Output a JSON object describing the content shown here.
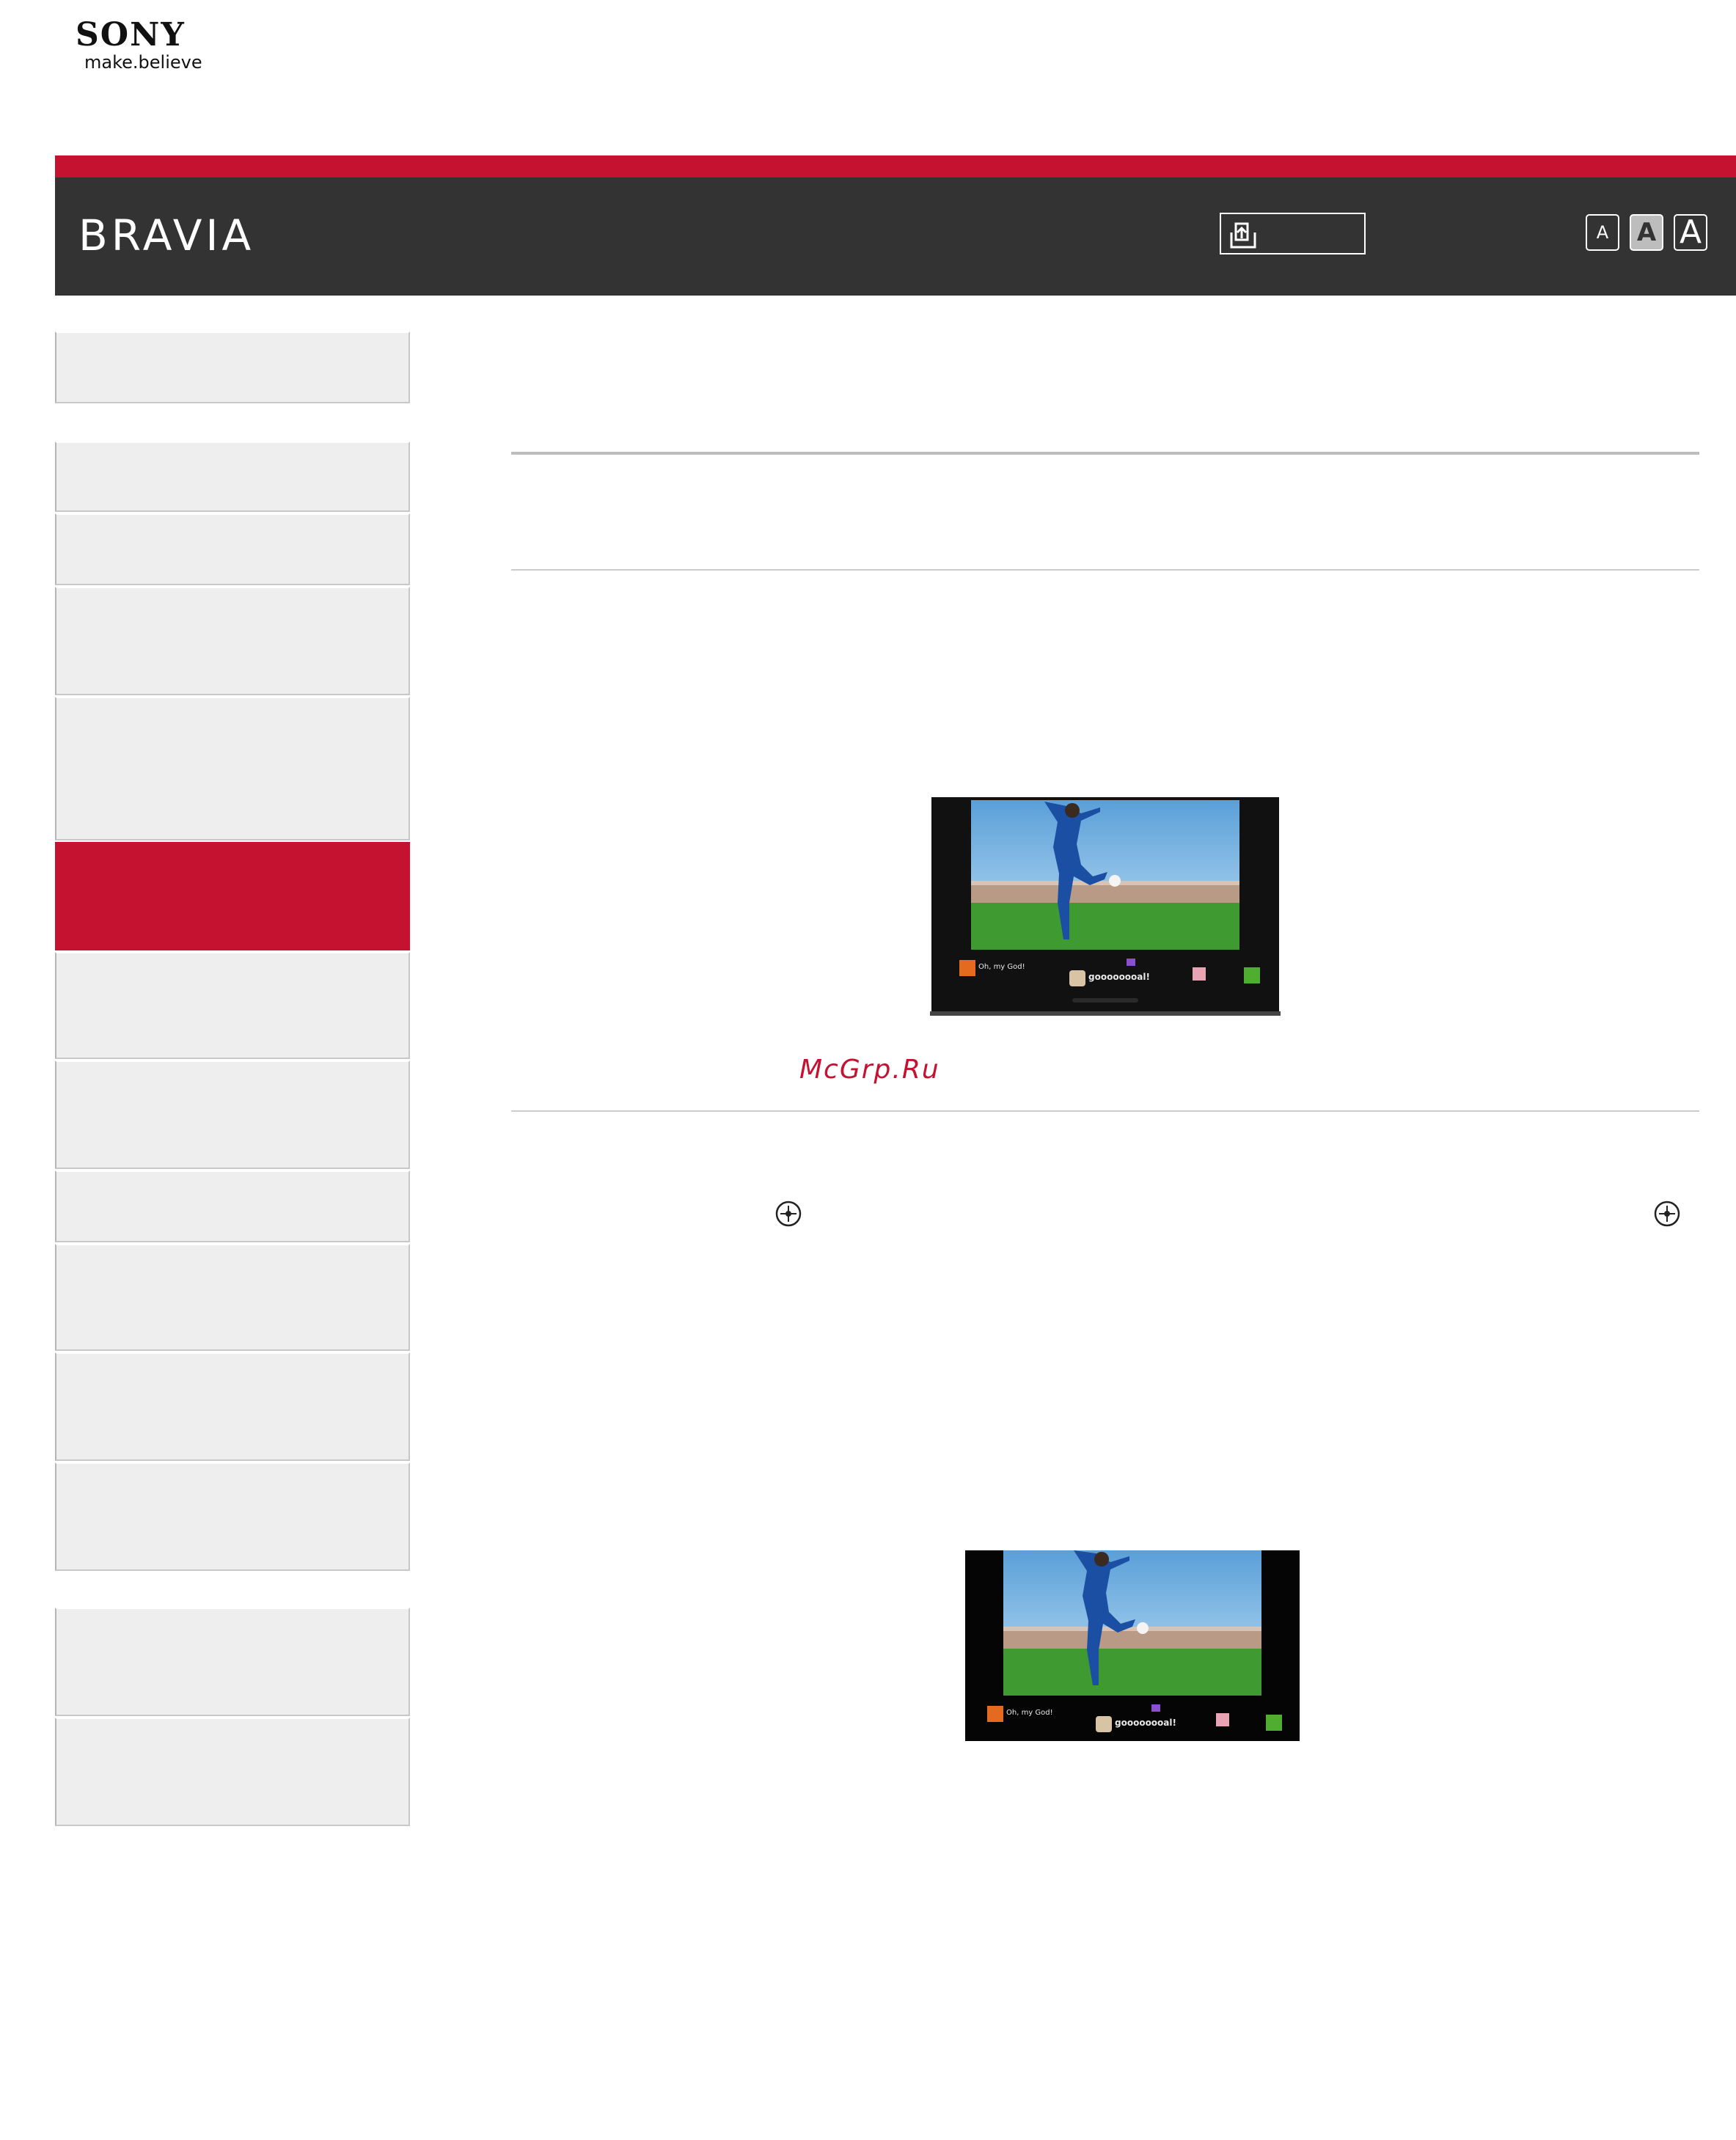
{
  "brand": {
    "name": "SONY",
    "tagline": "make.believe"
  },
  "header": {
    "title": "BRAVIA",
    "print_icon": "print-icon",
    "font_size_buttons": [
      {
        "label": "A",
        "size": "small"
      },
      {
        "label": "A",
        "size": "medium",
        "selected": true
      },
      {
        "label": "A",
        "size": "large"
      }
    ]
  },
  "sidebar": {
    "active_item": 7,
    "item_count": 15
  },
  "main": {
    "illustrations": [
      {
        "icon": "tv-social-viewing-illustration",
        "ticker": [
          "Oh, my God!",
          "goooooooal!"
        ]
      },
      {
        "icon": "tv-screen-social-viewing-illustration",
        "ticker": [
          "Oh, my God!",
          "goooooooal!"
        ]
      }
    ],
    "inline_icons": [
      "enter-button-icon",
      "enter-button-icon"
    ]
  },
  "watermark": "McGrp.Ru",
  "colors": {
    "accent": "#c41230",
    "header_bg": "#333333",
    "nav_bg": "#eeeeee"
  }
}
